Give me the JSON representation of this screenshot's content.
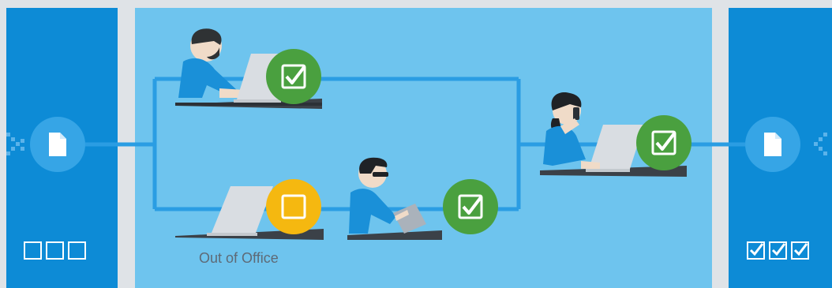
{
  "diagram": {
    "status_label": "Out of Office",
    "colors": {
      "outer_panel": "#0d8bd6",
      "middle_panel": "#6ec4ee",
      "connector": "#2a9de3",
      "approved": "#4aa03f",
      "pending": "#f5b810"
    },
    "left_status_boxes": [
      "empty",
      "empty",
      "empty"
    ],
    "right_status_boxes": [
      "checked",
      "checked",
      "checked"
    ],
    "icons": [
      "document-icon",
      "person-laptop-icon",
      "person-tablet-icon",
      "person-phone-icon",
      "check-icon",
      "pending-icon"
    ]
  }
}
